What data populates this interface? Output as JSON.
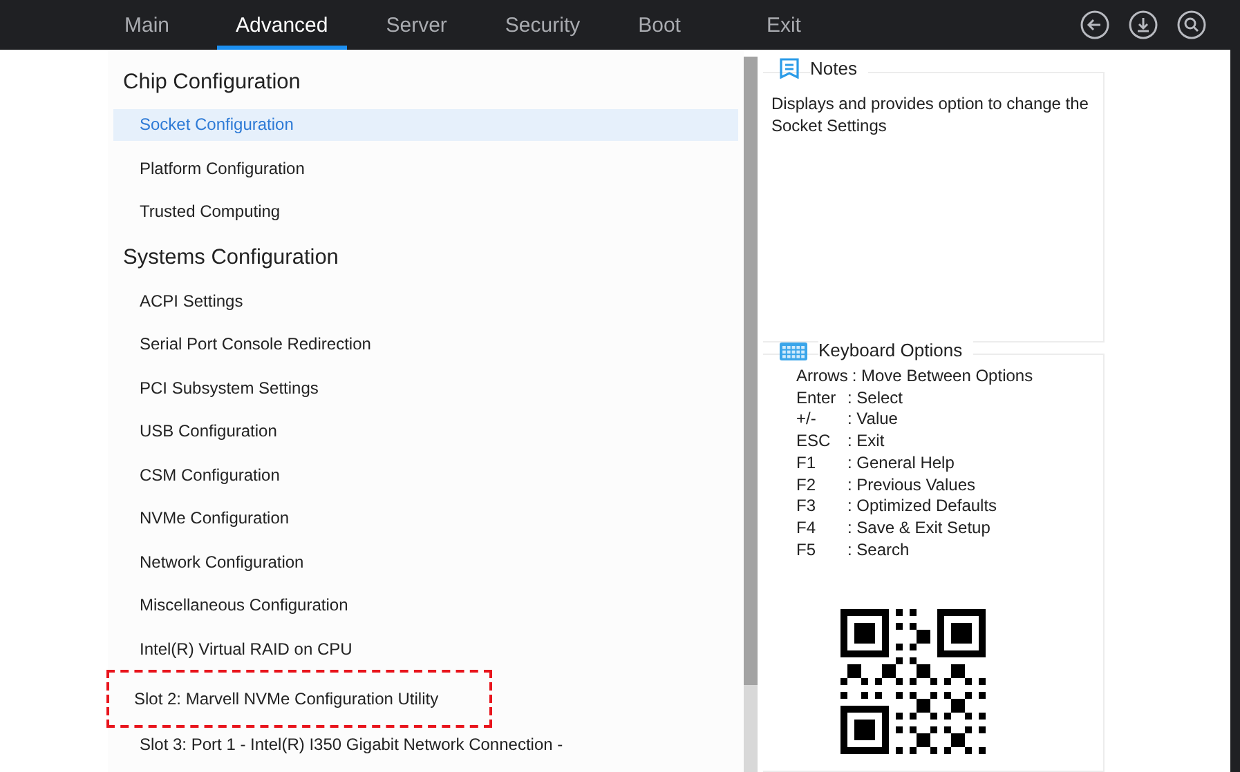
{
  "tabs": [
    {
      "label": "Main",
      "selected": false
    },
    {
      "label": "Advanced",
      "selected": true
    },
    {
      "label": "Server",
      "selected": false
    },
    {
      "label": "Security",
      "selected": false
    },
    {
      "label": "Boot",
      "selected": false
    },
    {
      "label": "Exit",
      "selected": false
    }
  ],
  "toolbar": [
    {
      "kind": "back"
    },
    {
      "kind": "save"
    },
    {
      "kind": "search"
    }
  ],
  "sections": [
    {
      "title": "Chip Configuration",
      "items": [
        {
          "label": "Socket Configuration",
          "selected": true,
          "annotated": false
        },
        {
          "label": "Platform Configuration",
          "selected": false,
          "annotated": false
        },
        {
          "label": "Trusted Computing",
          "selected": false,
          "annotated": false
        }
      ]
    },
    {
      "title": "Systems Configuration",
      "items": [
        {
          "label": "ACPI Settings",
          "selected": false,
          "annotated": false
        },
        {
          "label": "Serial Port Console Redirection",
          "selected": false,
          "annotated": false
        },
        {
          "label": "PCI Subsystem Settings",
          "selected": false,
          "annotated": false
        },
        {
          "label": "USB Configuration",
          "selected": false,
          "annotated": false
        },
        {
          "label": "CSM Configuration",
          "selected": false,
          "annotated": false
        },
        {
          "label": "NVMe Configuration",
          "selected": false,
          "annotated": false
        },
        {
          "label": "Network Configuration",
          "selected": false,
          "annotated": false
        },
        {
          "label": "Miscellaneous Configuration",
          "selected": false,
          "annotated": false
        },
        {
          "label": "Intel(R) Virtual RAID on CPU",
          "selected": false,
          "annotated": false
        },
        {
          "label": "Slot 2: Marvell NVMe Configuration Utility",
          "selected": false,
          "annotated": true
        },
        {
          "label": "Slot 3: Port 1 - Intel(R) I350 Gigabit Network Connection -",
          "selected": false,
          "annotated": false
        }
      ]
    }
  ],
  "notes": {
    "title": "Notes",
    "text": "Displays and provides option to change the Socket Settings"
  },
  "keyboard": {
    "title": "Keyboard Options",
    "keys": [
      {
        "key": "Arrows",
        "action": ": Move Between Options"
      },
      {
        "key": "Enter",
        "action": ": Select"
      },
      {
        "key": "+/-",
        "action": ": Value"
      },
      {
        "key": "ESC",
        "action": ": Exit"
      },
      {
        "key": "F1",
        "action": ": General Help"
      },
      {
        "key": "F2",
        "action": ": Previous Values"
      },
      {
        "key": "F3",
        "action": ": Optimized Defaults"
      },
      {
        "key": "F4",
        "action": ": Save & Exit Setup"
      },
      {
        "key": "F5",
        "action": ": Search"
      }
    ]
  }
}
